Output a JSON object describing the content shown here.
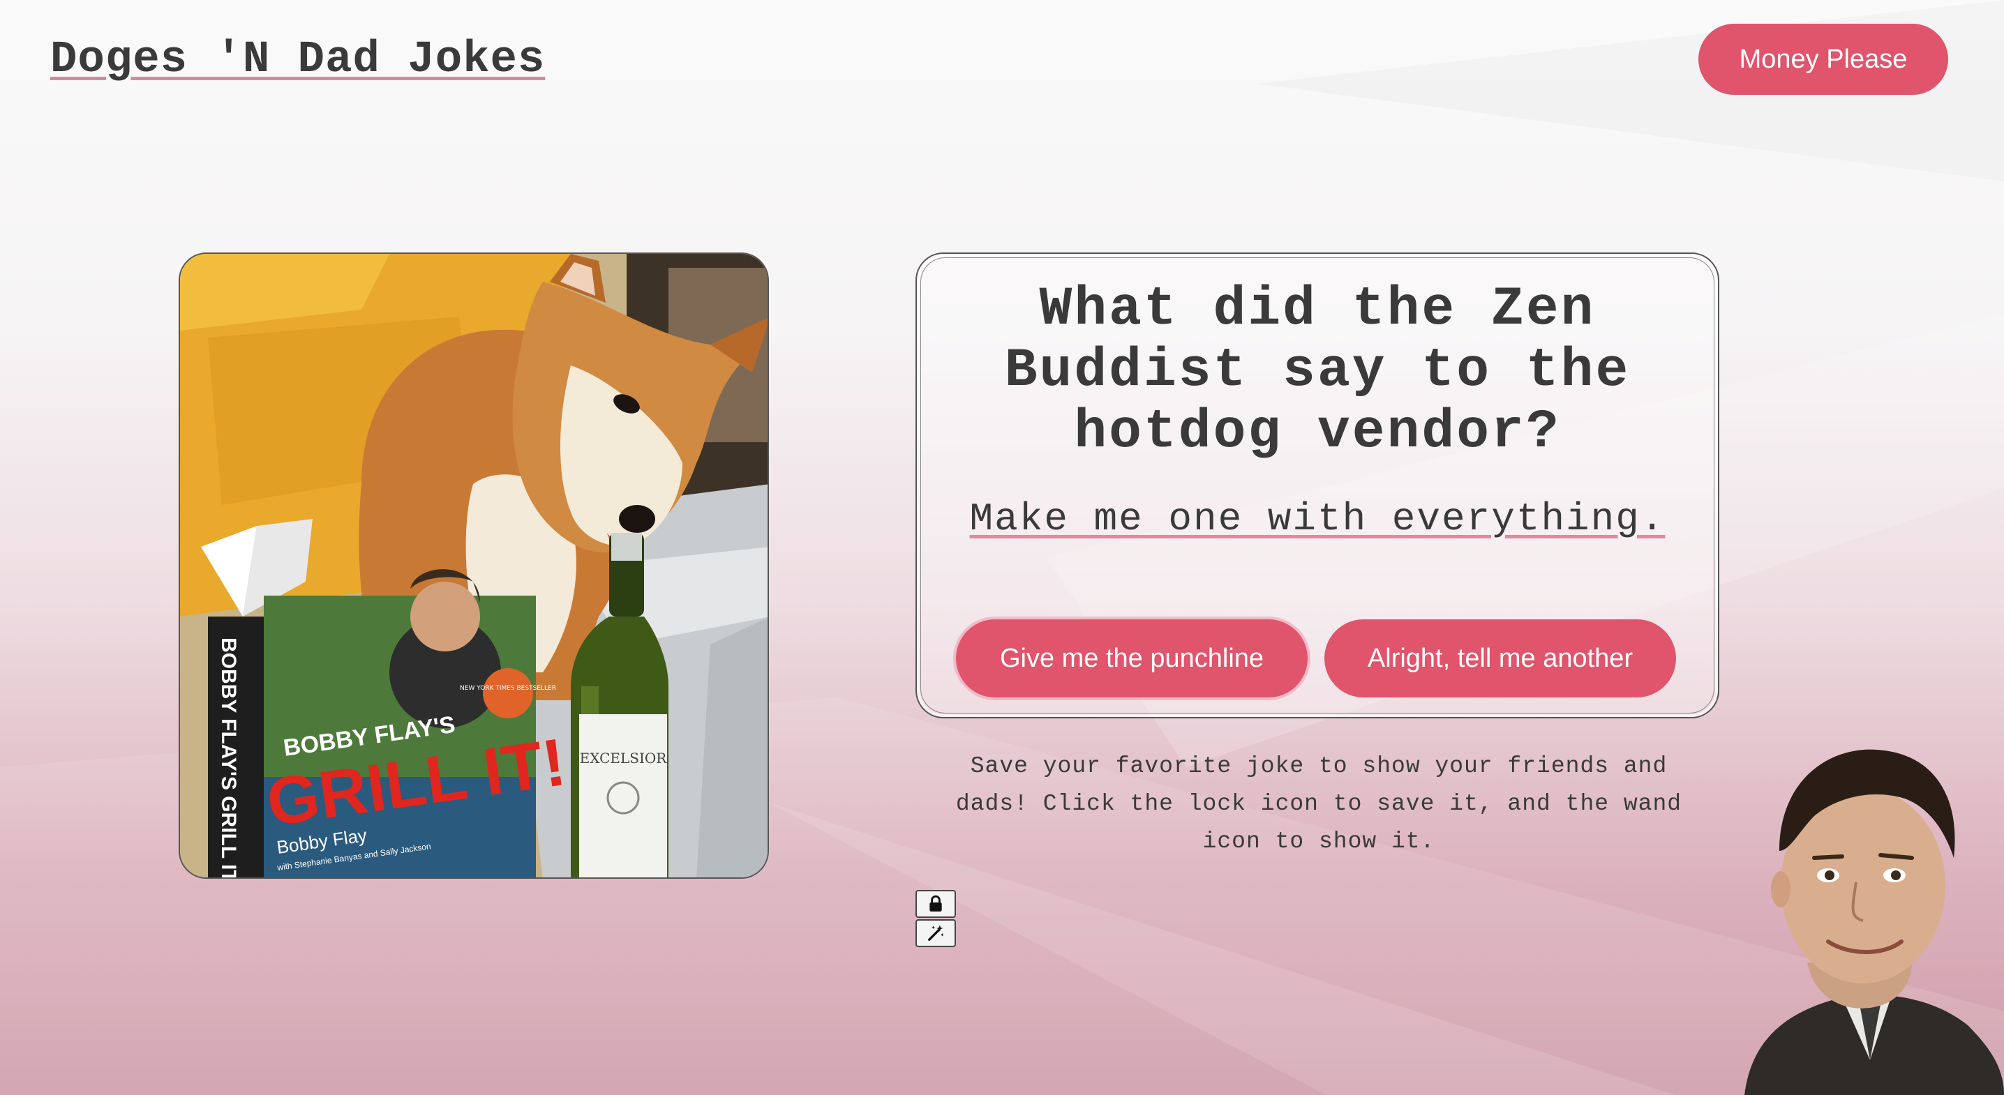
{
  "header": {
    "logo": "Doges 'N Dad Jokes",
    "money_button": "Money Please"
  },
  "joke": {
    "question": "What did the Zen Buddist say to the hotdog vendor?",
    "punchline": "Make me one with everything.",
    "punchline_button": "Give me the punchline",
    "another_button": "Alright, tell me another"
  },
  "save_instructions": "Save your favorite joke to show your friends and dads! Click the lock icon to save it, and the wand icon to show it.",
  "icons": {
    "lock": "lock-icon",
    "wand": "magic-wand-icon"
  },
  "images": {
    "doge_photo": {
      "book_spine": "BOBBY FLAY'S GRILL IT!",
      "book_title_top": "BOBBY FLAY'S",
      "book_title_main": "GRILL IT!",
      "book_author": "Bobby Flay",
      "book_coauthors": "with Stephanie Banyas and Sally Jackson",
      "book_badge": "NEW YORK TIMES BESTSELLER",
      "wine_label": "EXCELSIOR"
    }
  },
  "colors": {
    "accent": "#e0546c",
    "text": "#3a3a3a",
    "underline": "#d48a9c"
  }
}
